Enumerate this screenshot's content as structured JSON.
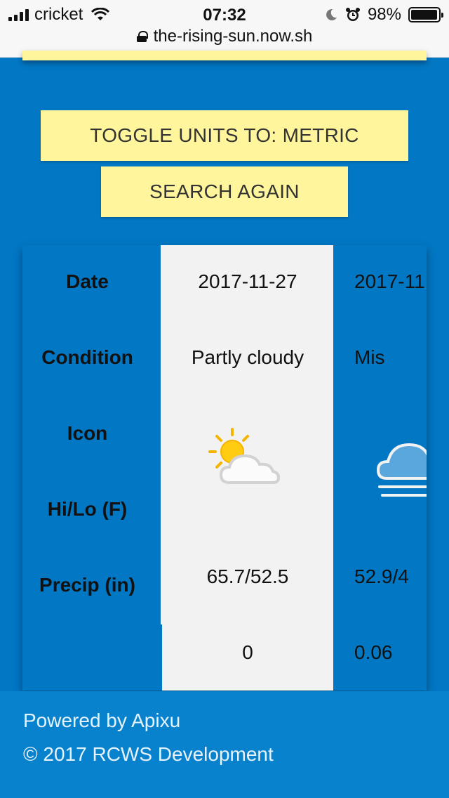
{
  "status_bar": {
    "carrier": "cricket",
    "time": "07:32",
    "battery": "98%",
    "battery_level": 0.98,
    "url": "the-rising-sun.now.sh"
  },
  "buttons": {
    "toggle_units": "TOGGLE UNITS TO: METRIC",
    "search_again": "SEARCH AGAIN"
  },
  "table": {
    "row_labels": [
      "Date",
      "Condition",
      "Icon",
      "Hi/Lo (F)",
      "Precip (in)"
    ],
    "days": [
      {
        "date": "2017-11-27",
        "condition": "Partly cloudy",
        "icon": "partly-cloudy-icon",
        "hilo": "65.7/52.5",
        "precip": "0"
      },
      {
        "date": "2017-11",
        "condition": "Mis",
        "icon": "mist-icon",
        "hilo": "52.9/4",
        "precip": "0.06"
      }
    ]
  },
  "footer": {
    "powered_by": "Powered by Apixu",
    "copyright": "© 2017 RCWS Development"
  },
  "colors": {
    "background": "#0277c4",
    "button": "#fff59d",
    "highlight_column": "#f2f2f2"
  }
}
